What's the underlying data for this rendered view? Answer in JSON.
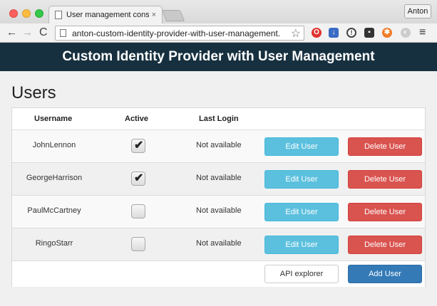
{
  "browser": {
    "tab_title": "User management console",
    "tab_close": "×",
    "profile_name": "Anton",
    "url": "anton-custom-identity-provider-with-user-management.",
    "back": "←",
    "forward": "→",
    "reload": "C",
    "star": "☆",
    "menu": "≡",
    "extensions": [
      {
        "name": "opera-icon",
        "glyph": "O"
      },
      {
        "name": "download-icon",
        "glyph": "↓"
      },
      {
        "name": "info-icon",
        "glyph": "!"
      },
      {
        "name": "media-icon",
        "glyph": "▪"
      },
      {
        "name": "orange-extension-icon",
        "glyph": "✱"
      },
      {
        "name": "grey-extension-icon",
        "glyph": "◐"
      }
    ]
  },
  "app": {
    "navbar_title": "Custom Identity Provider with User Management",
    "heading": "Users",
    "columns": {
      "username": "Username",
      "active": "Active",
      "last_login": "Last Login"
    },
    "users": [
      {
        "username": "JohnLennon",
        "active": true,
        "last_login": "Not available"
      },
      {
        "username": "GeorgeHarrison",
        "active": true,
        "last_login": "Not available"
      },
      {
        "username": "PaulMcCartney",
        "active": false,
        "last_login": "Not available"
      },
      {
        "username": "RingoStarr",
        "active": false,
        "last_login": "Not available"
      }
    ],
    "edit_label": "Edit User",
    "delete_label": "Delete User",
    "check_glyph": "✔",
    "api_explorer_label": "API explorer",
    "add_user_label": "Add User"
  },
  "colors": {
    "navbar": "#17303f",
    "edit": "#5bc0de",
    "delete": "#d9534f",
    "primary": "#337ab7"
  }
}
